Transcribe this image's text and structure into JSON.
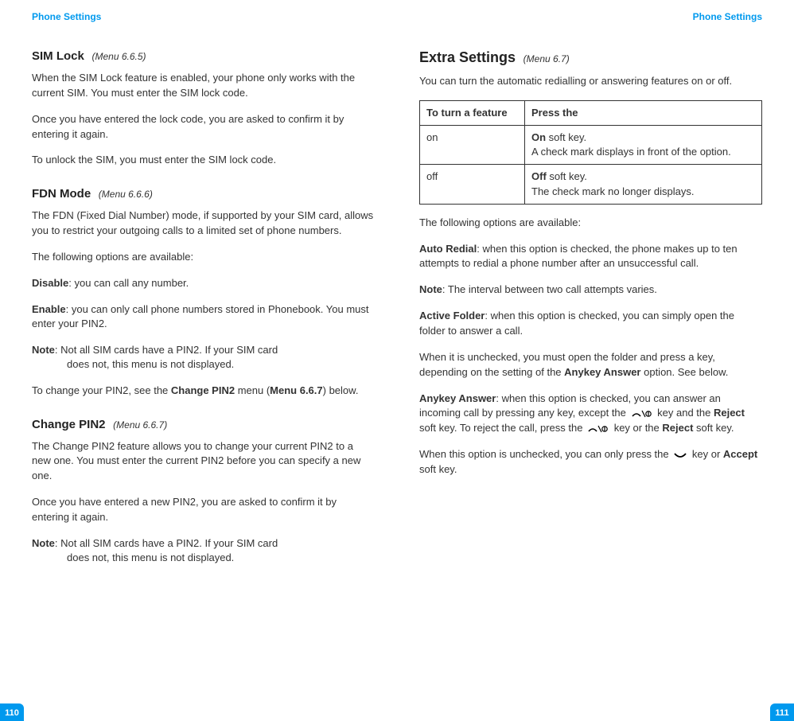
{
  "left": {
    "header": "Phone Settings",
    "pageNum": "110",
    "simLock": {
      "title": "SIM Lock",
      "menu": "(Menu 6.6.5)",
      "p1": "When the SIM Lock feature is enabled, your phone only works with the current SIM. You must enter the SIM lock code.",
      "p2": "Once you have entered the lock code, you are asked to confirm it by entering it again.",
      "p3": "To unlock the SIM, you must enter the SIM lock code."
    },
    "fdn": {
      "title": "FDN Mode",
      "menu": "(Menu 6.6.6)",
      "p1": "The FDN (Fixed Dial Number) mode, if supported by your SIM card, allows you to restrict your outgoing calls to a limited set of phone numbers.",
      "p2": "The following options are available:",
      "disableLabel": "Disable",
      "disableText": ": you can call any number.",
      "enableLabel": "Enable",
      "enableText": ": you can only call phone numbers stored in Phonebook. You must enter your PIN2.",
      "noteLabel": "Note",
      "noteText": ": Not all SIM cards have a PIN2. If your SIM card does not, this menu is not displayed.",
      "p3a": "To change your PIN2, see the ",
      "p3b": "Change PIN2",
      "p3c": " menu (",
      "p3d": "Menu 6.6.7",
      "p3e": ") below."
    },
    "pin2": {
      "title": "Change PIN2",
      "menu": "(Menu 6.6.7)",
      "p1": "The Change PIN2 feature allows you to change your current PIN2 to a new one. You must enter the current PIN2 before you can specify a new one.",
      "p2": "Once you have entered a new PIN2, you are asked to confirm it by entering it again.",
      "noteLabel": "Note",
      "noteText": ": Not all SIM cards have a PIN2. If your SIM card does not, this menu is not displayed."
    }
  },
  "right": {
    "header": "Phone Settings",
    "pageNum": "111",
    "extra": {
      "title": "Extra Settings",
      "menu": "(Menu 6.7)",
      "p1": "You can turn the automatic redialling or answering features on or off.",
      "table": {
        "h1": "To turn a feature",
        "h2": "Press the",
        "r1c1": "on",
        "r1c2a": "On",
        "r1c2b": " soft key.",
        "r1c2c": "A check mark displays in front of the option.",
        "r2c1": "off",
        "r2c2a": "Off",
        "r2c2b": " soft key.",
        "r2c2c": "The check mark no longer displays."
      },
      "p2": "The following options are available:",
      "autoRedialLabel": "Auto Redial",
      "autoRedialText": ": when this option is checked, the phone makes up to ten attempts to redial a phone number after an unsuccessful call.",
      "noteLabel": "Note",
      "noteText": ": The interval between two call attempts varies.",
      "activeFolderLabel": "Active Folder",
      "activeFolderText": ": when this option is checked, you can simply open the folder to answer a call.",
      "p3a": "When it is unchecked, you must open the folder and press a key, depending on the setting of the ",
      "p3b": "Anykey Answer",
      "p3c": " option. See below.",
      "anykeyLabel": "Anykey Answer",
      "anykeyText1": ": when this option is checked, you can answer an incoming call by pressing any key, except the ",
      "anykeyText2": " key and the ",
      "anykeyReject1": "Reject",
      "anykeyText3": " soft key. To reject the call, press the ",
      "anykeyText4": " key or the ",
      "anykeyReject2": "Reject",
      "anykeyText5": " soft key.",
      "p4a": "When this option is unchecked, you can only press the ",
      "p4b": " key or ",
      "p4c": "Accept",
      "p4d": " soft key."
    }
  }
}
